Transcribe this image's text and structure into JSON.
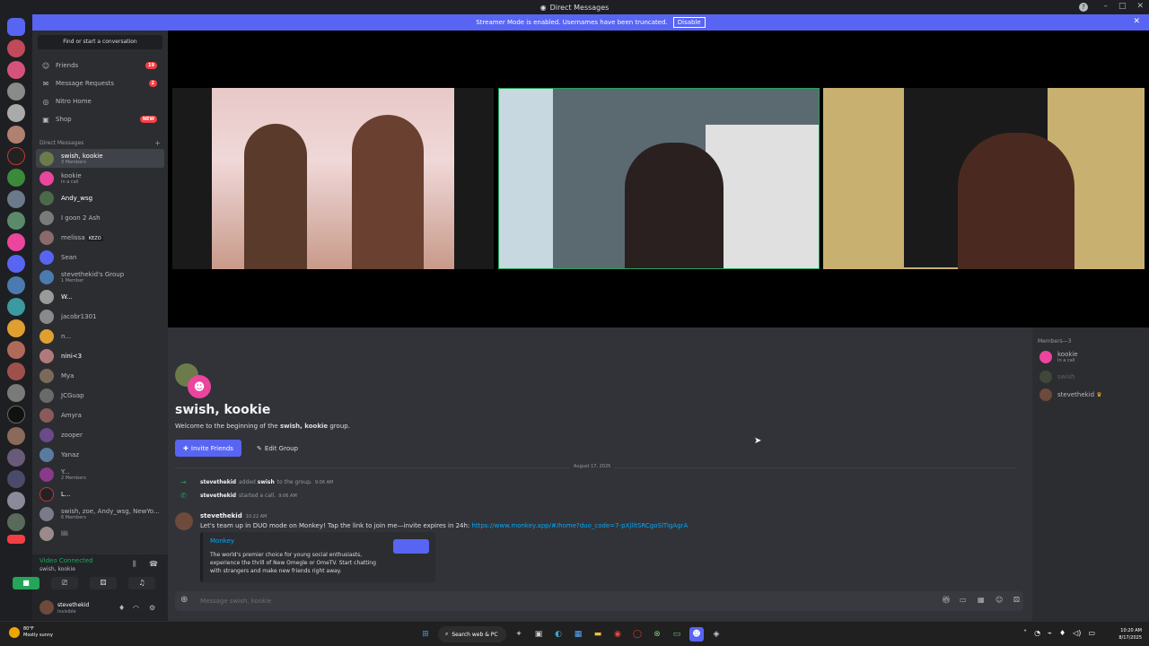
{
  "window": {
    "title": "Direct Messages"
  },
  "banner": {
    "text": "Streamer Mode is enabled. Usernames have been truncated.",
    "disable_label": "Disable"
  },
  "sidebar": {
    "find_placeholder": "Find or start a conversation",
    "nav": [
      {
        "label": "Friends",
        "badge": "19"
      },
      {
        "label": "Message Requests",
        "badge": "2"
      },
      {
        "label": "Nitro Home",
        "badge": ""
      },
      {
        "label": "Shop",
        "badge": "NEW"
      }
    ],
    "dm_header": "Direct Messages",
    "dms": [
      {
        "name": "swish, kookie",
        "sub": "3 Members"
      },
      {
        "name": "kookie",
        "sub": "In a call"
      },
      {
        "name": "Andy_wsg",
        "sub": ""
      },
      {
        "name": "I goon 2 Ash",
        "sub": ""
      },
      {
        "name": "melissa",
        "sub": "",
        "tag": "KEZO"
      },
      {
        "name": "Sean",
        "sub": ""
      },
      {
        "name": "stevethekid's Group",
        "sub": "1 Member"
      },
      {
        "name": "W...",
        "sub": ""
      },
      {
        "name": "jacobr1301",
        "sub": ""
      },
      {
        "name": "n...",
        "sub": ""
      },
      {
        "name": "nini<3",
        "sub": ""
      },
      {
        "name": "Mya",
        "sub": ""
      },
      {
        "name": "JCGuap",
        "sub": ""
      },
      {
        "name": "Amyra",
        "sub": ""
      },
      {
        "name": "zooper",
        "sub": ""
      },
      {
        "name": "Yanaz",
        "sub": ""
      },
      {
        "name": "Y...",
        "sub": "2 Members"
      },
      {
        "name": "L...",
        "sub": ""
      },
      {
        "name": "swish, zoe, Andy_wsg, NewYo...",
        "sub": "6 Members"
      },
      {
        "name": "lili",
        "sub": ""
      }
    ]
  },
  "voice": {
    "status": "Video Connected",
    "channel": "swish, kookie"
  },
  "user": {
    "name": "stevethekid",
    "status": "Invisible"
  },
  "main": {
    "group_title": "swish, kookie",
    "welcome_prefix": "Welcome to the beginning of the ",
    "welcome_group": "swish, kookie",
    "welcome_suffix": " group.",
    "invite_label": "Invite Friends",
    "edit_label": "Edit Group",
    "date": "August 17, 2025",
    "sys1": {
      "user": "stevethekid",
      "text": "added",
      "target": "swish",
      "suffix": "to the group.",
      "time": "9:06 AM"
    },
    "sys2": {
      "user": "stevethekid",
      "text": "started a call.",
      "time": "9:06 AM"
    },
    "message": {
      "author": "stevethekid",
      "time": "10:22 AM",
      "text": "Let's team up in DUO mode on Monkey! Tap the link to join me—invite expires in 24h: ",
      "link": "https://www.monkey.app/#/home?duo_code=7-pXjlltSRCgoSlTigAgrA"
    },
    "embed": {
      "title": "Monkey",
      "description": "The world's premier choice for young social enthusiasts, experience the thrill of New Omegle or OmeTV. Start chatting with strangers and make new friends right away."
    },
    "chat_placeholder": "Message swish, kookie"
  },
  "members": {
    "header": "Members—3",
    "list": [
      {
        "name": "kookie",
        "sub": "In a call"
      },
      {
        "name": "swish",
        "sub": ""
      },
      {
        "name": "stevethekid",
        "sub": ""
      }
    ]
  },
  "taskbar": {
    "weather_temp": "80°F",
    "weather_text": "Mostly sunny",
    "search_label": "Search web & PC",
    "time": "10:20 AM",
    "date": "8/17/2025"
  },
  "colors": {
    "accent": "#5865f2",
    "online": "#23a55a",
    "alert": "#f23f43"
  }
}
